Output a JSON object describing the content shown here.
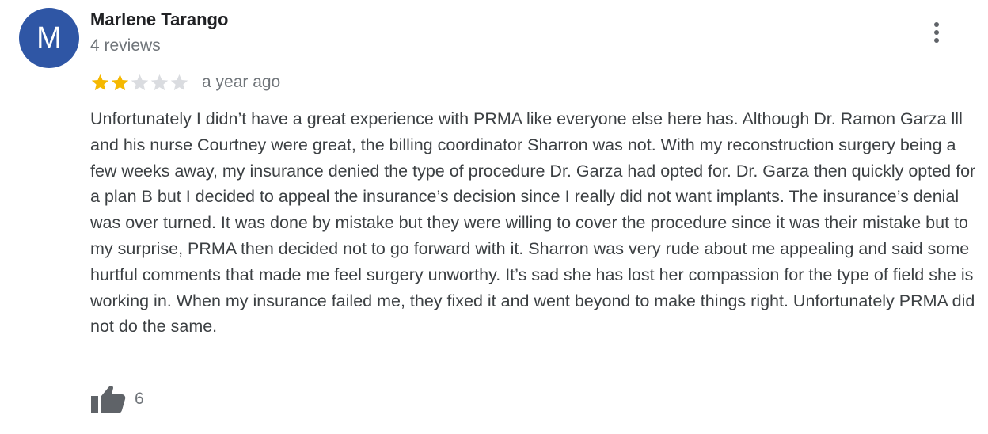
{
  "review": {
    "avatar_letter": "M",
    "avatar_color": "#2f56a5",
    "reviewer_name": "Marlene Tarango",
    "reviewer_meta": "4 reviews",
    "rating": 2,
    "rating_max": 5,
    "star_color_filled": "#f5b800",
    "star_color_empty": "#dadce0",
    "time_ago": "a year ago",
    "text": "Unfortunately I didn’t have a great experience with PRMA like everyone else here has. Although Dr. Ramon Garza lll and his nurse Courtney were great, the billing coordinator Sharron was not. With my reconstruction surgery being a few weeks away, my insurance denied the type of procedure Dr. Garza had opted for. Dr. Garza then quickly opted for a plan B but I decided to appeal the insurance’s decision since I really did not want implants. The insurance’s denial was over turned. It was done by mistake but they were willing to cover the procedure since it was their mistake but to my surprise, PRMA then decided not to go forward with it. Sharron was very rude about me appealing and said some hurtful comments that made me feel surgery unworthy. It’s sad she has lost her compassion for the type of field she is working in. When my insurance failed me, they fixed it and went beyond to make things right. Unfortunately PRMA did not do the same.",
    "like_count": "6",
    "icons": {
      "more": "more-vert-icon",
      "like": "thumbs-up-icon",
      "star": "star-icon"
    }
  }
}
